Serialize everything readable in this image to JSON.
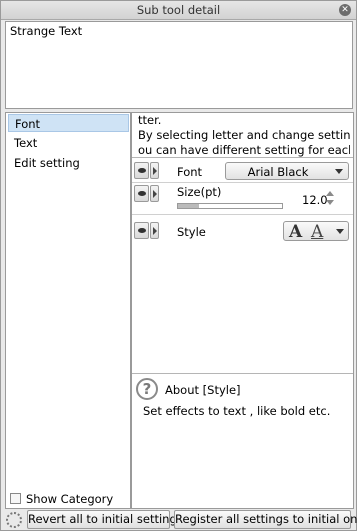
{
  "window": {
    "title": "Sub tool detail"
  },
  "preview": {
    "text": "Strange Text"
  },
  "categories": [
    {
      "label": "Font",
      "selected": true
    },
    {
      "label": "Text",
      "selected": false
    },
    {
      "label": "Edit setting",
      "selected": false
    }
  ],
  "show_category": {
    "label": "Show Category",
    "checked": false
  },
  "description": {
    "line1": "tter.",
    "line2": "By selecting letter and change settings, y",
    "line3": "ou can have different setting for each lett"
  },
  "properties": {
    "font": {
      "label": "Font",
      "value": "Arial Black"
    },
    "size": {
      "label": "Size(pt)",
      "value": "12.0",
      "fraction": 0.2
    },
    "style": {
      "label": "Style"
    }
  },
  "help": {
    "title": "About [Style]",
    "text": "Set effects to text , like bold etc."
  },
  "footer": {
    "revert_label": "Revert all to initial settings",
    "register_label": "Register all settings to initial ones"
  },
  "colors": {
    "selected_bg": "#cfe3f5",
    "panel_bg": "#e9e9e9"
  },
  "icons": [
    "close-icon",
    "eye-icon",
    "expand-arrow-icon",
    "chevron-down-icon",
    "spin-up-icon",
    "spin-down-icon",
    "bold-text-icon",
    "outline-text-icon",
    "help-icon",
    "settings-icon"
  ]
}
